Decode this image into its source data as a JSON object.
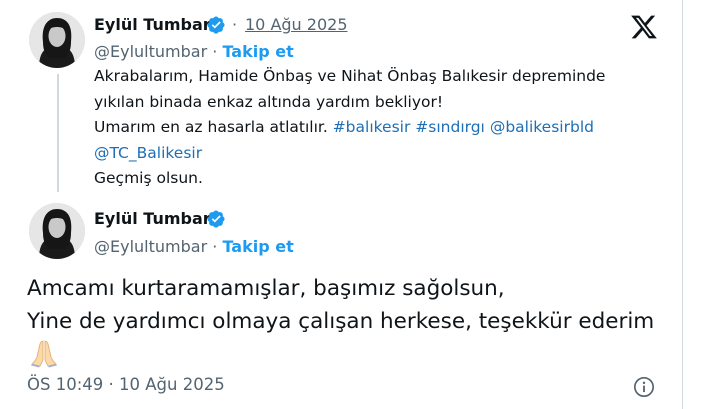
{
  "reply_tweet": {
    "author_name": "Eylül Tumbar",
    "date": "10 Ağu 2025",
    "handle": "@Eylultumbar",
    "separator": "·",
    "follow_label": "Takip et",
    "text_line1": "Akrabalarım, Hamide Önbaş ve Nihat Önbaş Balıkesir depreminde",
    "text_line2": "yıkılan binada enkaz altında yardım bekliyor!",
    "text_line3_prefix": "Umarım en az hasarla atlatılır. ",
    "hashtags": [
      "#balıkesir",
      "#sındırgı"
    ],
    "mentions": [
      "@balikesirbld",
      "@TC_Balikesir"
    ],
    "text_line5": "Geçmiş olsun."
  },
  "main_tweet": {
    "author_name": "Eylül Tumbar",
    "handle": "@Eylultumbar",
    "separator": "·",
    "follow_label": "Takip et",
    "text_line1": "Amcamı kurtaramamışlar, başımız sağolsun,",
    "text_line2": "Yine de yardımcı olmaya çalışan herkese, teşekkür ederim",
    "emoji": "folded-hands",
    "timestamp": "ÖS 10:49 · 10 Ağu 2025"
  },
  "icons": {
    "brand": "x-logo-icon",
    "verified": "verified-badge-icon",
    "info": "info-icon"
  },
  "colors": {
    "link": "#1d9bf0",
    "text": "#0f1419",
    "muted": "#536471",
    "verified": "#1d9bf0"
  }
}
